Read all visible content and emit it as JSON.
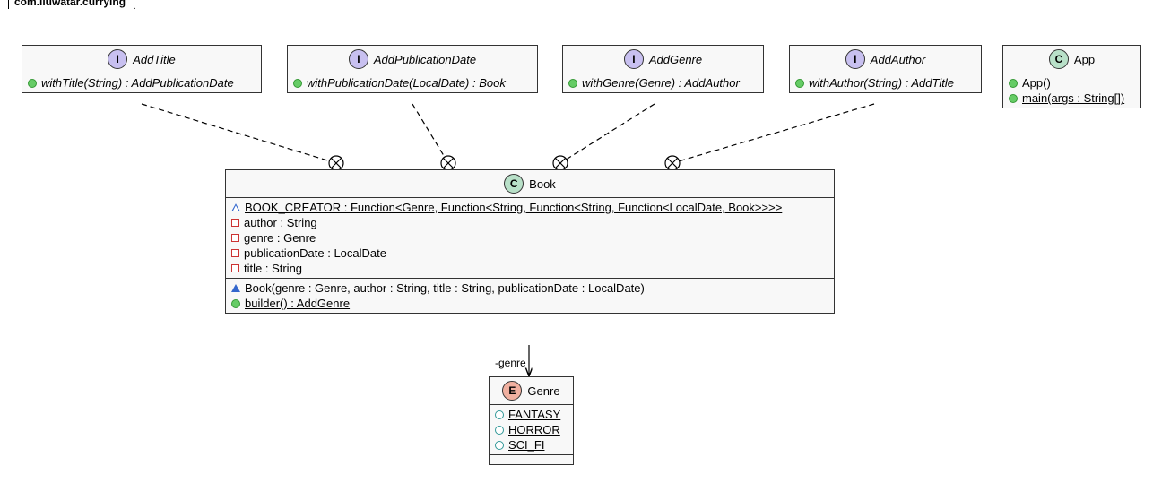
{
  "package": {
    "name": "com.iluwatar.currying"
  },
  "interfaces": {
    "addTitle": {
      "name": "AddTitle",
      "method": "withTitle(String) : AddPublicationDate"
    },
    "addPublicationDate": {
      "name": "AddPublicationDate",
      "method": "withPublicationDate(LocalDate) : Book"
    },
    "addGenre": {
      "name": "AddGenre",
      "method": "withGenre(Genre) : AddAuthor"
    },
    "addAuthor": {
      "name": "AddAuthor",
      "method": "withAuthor(String) : AddTitle"
    }
  },
  "classes": {
    "app": {
      "name": "App",
      "ctor": "App()",
      "main": "main(args : String[])"
    },
    "book": {
      "name": "Book",
      "fields": {
        "creator": "BOOK_CREATOR : Function<Genre, Function<String, Function<String, Function<LocalDate, Book>>>>",
        "author": "author : String",
        "genre": "genre : Genre",
        "pubDate": "publicationDate : LocalDate",
        "title": "title : String"
      },
      "methods": {
        "ctor": "Book(genre : Genre, author : String, title : String, publicationDate : LocalDate)",
        "builder": "builder() : AddGenre"
      }
    }
  },
  "enums": {
    "genre": {
      "name": "Genre",
      "values": {
        "fantasy": "FANTASY",
        "horror": "HORROR",
        "scifi": "SCI_FI"
      }
    }
  },
  "relations": {
    "genreLabel": "-genre"
  },
  "stereotype_letters": {
    "I": "I",
    "C": "C",
    "E": "E"
  }
}
